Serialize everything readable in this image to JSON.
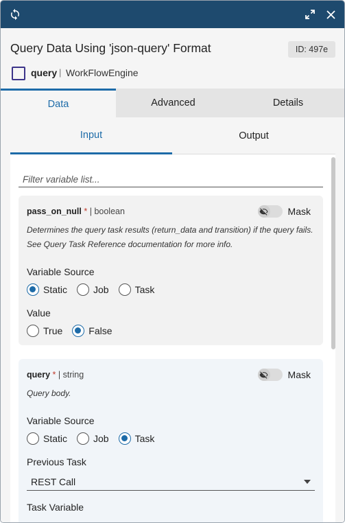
{
  "window": {
    "refresh_icon": "refresh-icon",
    "expand_icon": "expand-icon",
    "close_icon": "close-icon",
    "titlebar_color": "#1e4a6e",
    "accent_color": "#1d6ba8"
  },
  "header": {
    "title": "Query Data Using 'json-query' Format",
    "id_badge": "ID: 497e",
    "task_name": "query",
    "separator": "|",
    "app_name": "WorkFlowEngine"
  },
  "tabs": [
    {
      "label": "Data",
      "active": true
    },
    {
      "label": "Advanced",
      "active": false
    },
    {
      "label": "Details",
      "active": false
    }
  ],
  "subtabs": [
    {
      "label": "Input",
      "active": true
    },
    {
      "label": "Output",
      "active": false
    }
  ],
  "filter": {
    "placeholder": "Filter variable list..."
  },
  "variables": [
    {
      "name": "pass_on_null",
      "required_mark": "*",
      "type_text": "| boolean",
      "mask_label": "Mask",
      "description": "Determines the query task results (return_data and transition) if the query fails. See Query Task Reference documentation for more info.",
      "source_label": "Variable Source",
      "source_options": [
        "Static",
        "Job",
        "Task"
      ],
      "source_selected": "Static",
      "value_label": "Value",
      "value_options": [
        "True",
        "False"
      ],
      "value_selected": "False"
    },
    {
      "name": "query",
      "required_mark": "*",
      "type_text": "| string",
      "mask_label": "Mask",
      "description": "Query body.",
      "source_label": "Variable Source",
      "source_options": [
        "Static",
        "Job",
        "Task"
      ],
      "source_selected": "Task",
      "previous_task_label": "Previous Task",
      "previous_task_value": "REST Call",
      "task_variable_label": "Task Variable"
    }
  ]
}
